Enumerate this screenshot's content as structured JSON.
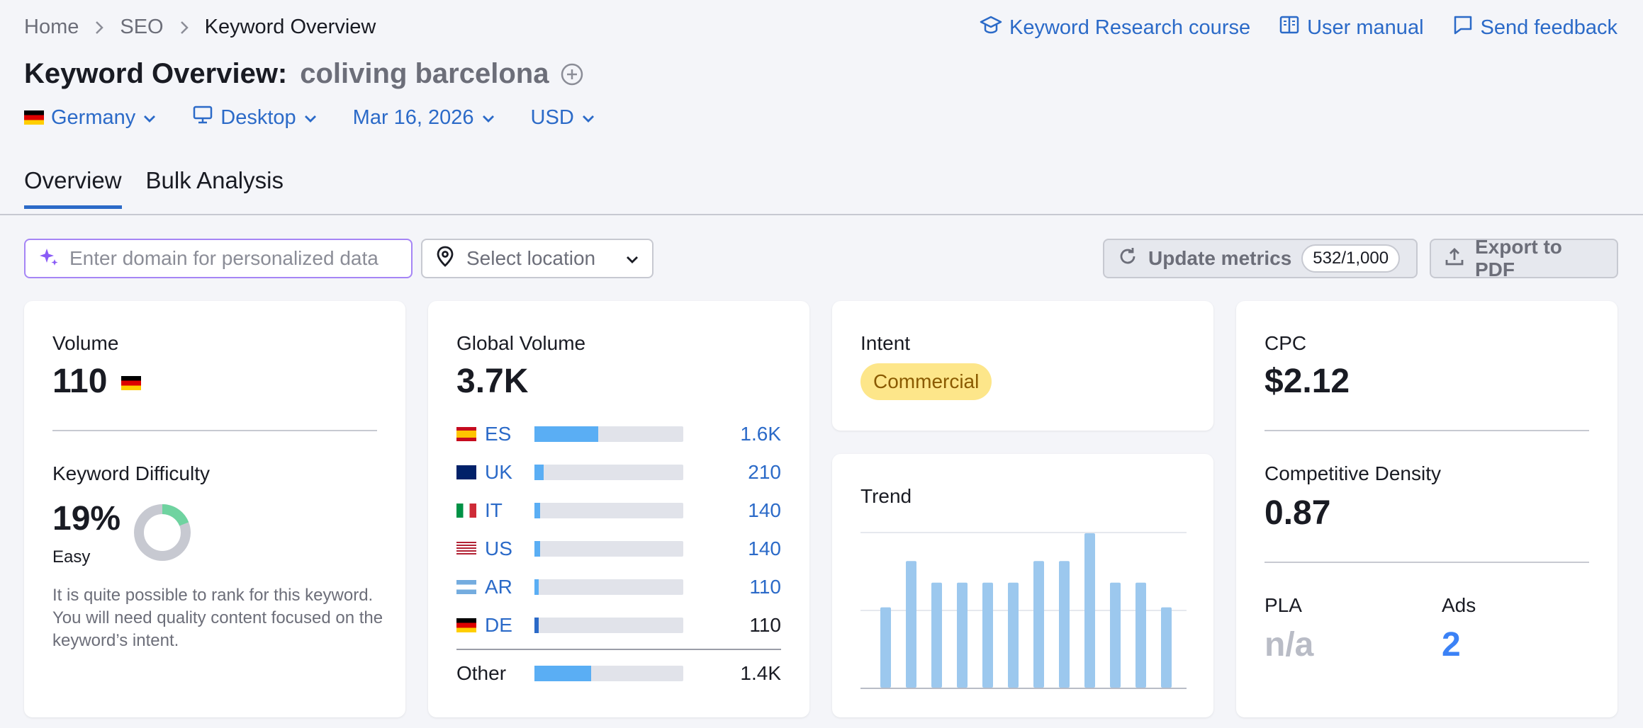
{
  "breadcrumb": [
    "Home",
    "SEO",
    "Keyword Overview"
  ],
  "top_links": [
    {
      "label": "Keyword Research course",
      "icon": "graduation-cap-icon"
    },
    {
      "label": "User manual",
      "icon": "book-icon"
    },
    {
      "label": "Send feedback",
      "icon": "feedback-icon"
    }
  ],
  "title": {
    "prefix": "Keyword Overview:",
    "keyword": "coliving barcelona"
  },
  "filters": {
    "country": "Germany",
    "device": "Desktop",
    "date": "Mar 16, 2026",
    "currency": "USD"
  },
  "tabs": [
    "Overview",
    "Bulk Analysis"
  ],
  "toolbar": {
    "domain_placeholder": "Enter domain for personalized data",
    "location_placeholder": "Select location",
    "update_label": "Update metrics",
    "update_count": "532/1,000",
    "export_label": "Export to PDF"
  },
  "volume": {
    "label": "Volume",
    "value": "110"
  },
  "difficulty": {
    "label": "Keyword Difficulty",
    "value": "19%",
    "level": "Easy",
    "percent": 19,
    "description": "It is quite possible to rank for this keyword. You will need quality content focused on the keyword’s intent."
  },
  "global_volume": {
    "label": "Global Volume",
    "value": "3.7K",
    "rows": [
      {
        "code": "ES",
        "value": "1.6K",
        "share": 0.43
      },
      {
        "code": "UK",
        "value": "210",
        "share": 0.06
      },
      {
        "code": "IT",
        "value": "140",
        "share": 0.04
      },
      {
        "code": "US",
        "value": "140",
        "share": 0.04
      },
      {
        "code": "AR",
        "value": "110",
        "share": 0.03
      },
      {
        "code": "DE",
        "value": "110",
        "share": 0.03
      }
    ],
    "other": {
      "label": "Other",
      "value": "1.4K",
      "share": 0.38
    }
  },
  "intent": {
    "label": "Intent",
    "value": "Commercial"
  },
  "trend": {
    "label": "Trend",
    "values": [
      52,
      82,
      68,
      68,
      68,
      68,
      82,
      82,
      100,
      68,
      68,
      52
    ]
  },
  "cpc": {
    "label": "CPC",
    "value": "$2.12"
  },
  "competitive_density": {
    "label": "Competitive Density",
    "value": "0.87"
  },
  "pla": {
    "label": "PLA",
    "value": "n/a"
  },
  "ads": {
    "label": "Ads",
    "value": "2"
  },
  "colors": {
    "accent": "#2b6ac8",
    "bar": "#5aaef4",
    "trend_bar": "#9cc8ee",
    "kd_green": "#6fd3a0"
  }
}
